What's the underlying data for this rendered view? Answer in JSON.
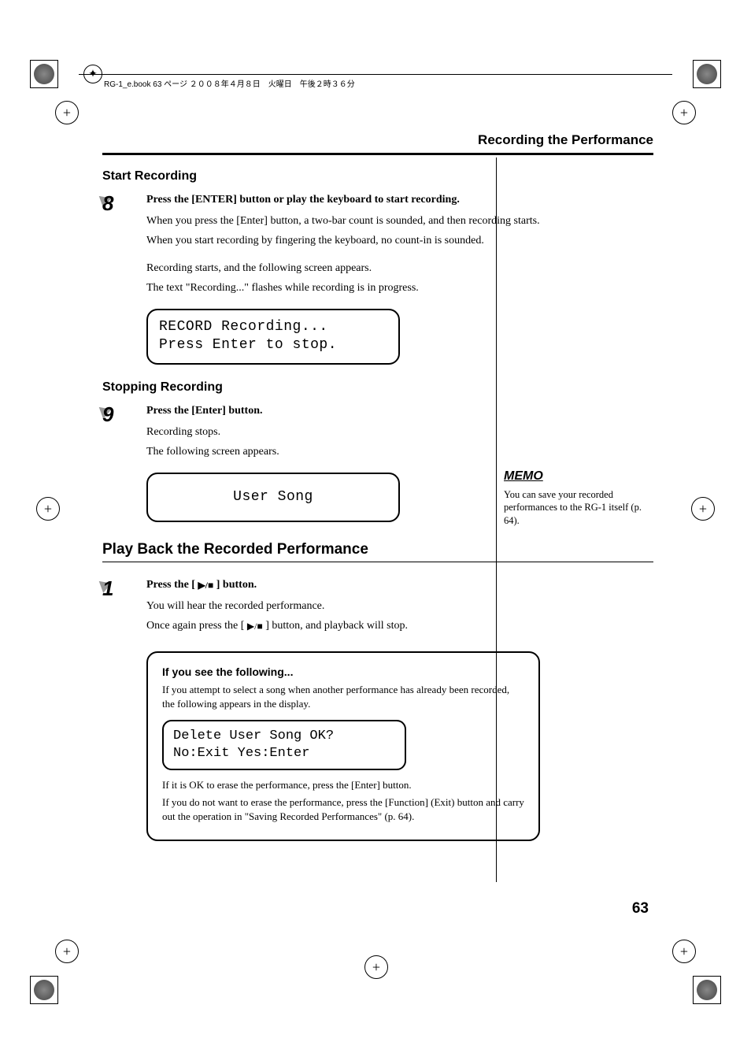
{
  "header": {
    "file_info": "RG-1_e.book  63 ページ  ２００８年４月８日　火曜日　午後２時３６分",
    "section_title": "Recording the Performance"
  },
  "section1": {
    "heading": "Start Recording",
    "step_num": "8",
    "lead": "Press the [ENTER] button or play the keyboard to start recording.",
    "p1": "When you press the [Enter] button, a two-bar count is sounded, and then recording starts.",
    "p2": "When you start recording by fingering the keyboard, no count-in is sounded.",
    "p3": "Recording starts, and the following screen appears.",
    "p4": "The text \"Recording...\" flashes while recording is in progress.",
    "display_l1": "RECORD  Recording...",
    "display_l2": "Press Enter to stop."
  },
  "section2": {
    "heading": "Stopping Recording",
    "step_num": "9",
    "lead": "Press the [Enter] button.",
    "p1": "Recording stops.",
    "p2": "The following screen appears.",
    "display": "User Song"
  },
  "section3": {
    "heading": "Play Back the Recorded Performance",
    "step_num": "1",
    "lead_a": "Press the [ ",
    "lead_b": " ] button.",
    "p1": "You will hear the recorded performance.",
    "p2_a": "Once again press the [ ",
    "p2_b": " ] button, and playback will stop."
  },
  "infobox": {
    "title": "If you see the following...",
    "p1": "If you attempt to select a song when another performance has already been recorded, the following appears in the display.",
    "display_l1": "Delete User Song OK?",
    "display_l2": " No:Exit  Yes:Enter",
    "p2": "If it is OK to erase the performance, press the [Enter] button.",
    "p3": "If you do not want to erase the performance, press the [Function] (Exit) button and carry out the operation in \"Saving Recorded Performances\" (p. 64)."
  },
  "memo": {
    "label": "MEMO",
    "text": "You can save your recorded performances to the RG-1 itself (p. 64)."
  },
  "page_number": "63",
  "icons": {
    "playstop": "▶/■"
  }
}
